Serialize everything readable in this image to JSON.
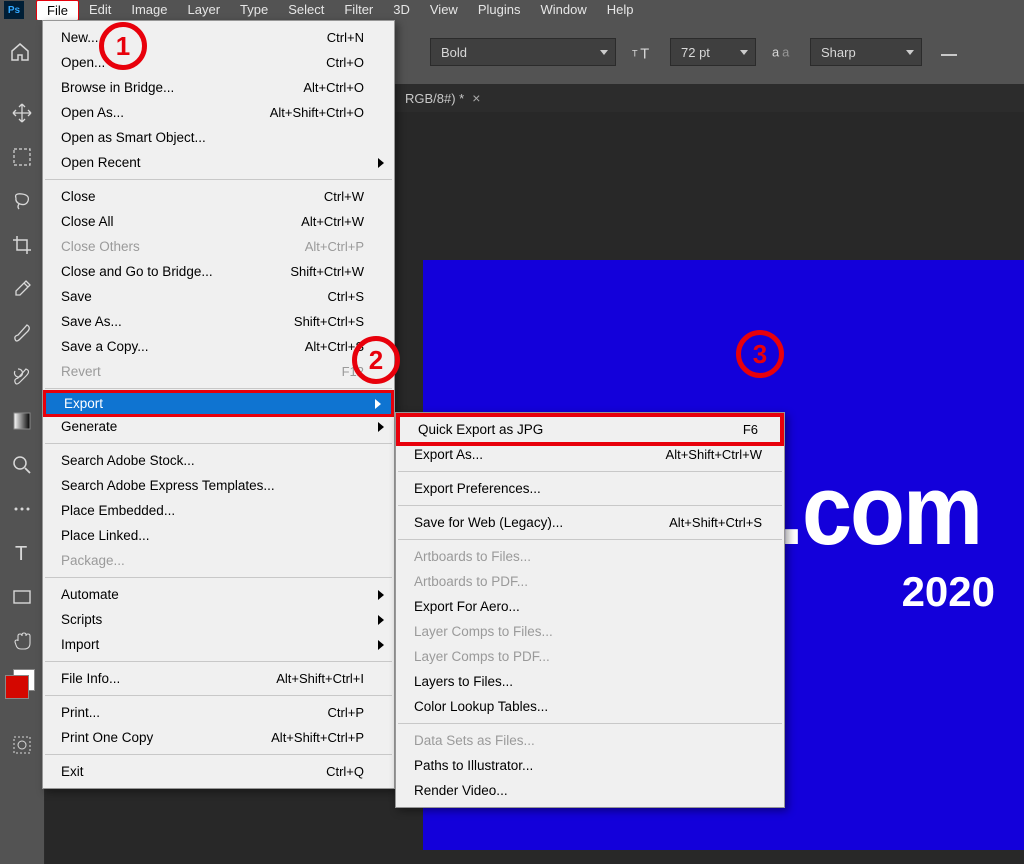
{
  "menubar": {
    "items": [
      "File",
      "Edit",
      "Image",
      "Layer",
      "Type",
      "Select",
      "Filter",
      "3D",
      "View",
      "Plugins",
      "Window",
      "Help"
    ]
  },
  "options": {
    "fontStyle": "Bold",
    "fontSize": "72 pt",
    "antialias": "Sharp"
  },
  "tab": {
    "label": "RGB/8#) *"
  },
  "document": {
    "textCom": ".com",
    "textYear": "2020"
  },
  "fileMenu": [
    {
      "label": "New...",
      "shortcut": "Ctrl+N"
    },
    {
      "label": "Open...",
      "shortcut": "Ctrl+O"
    },
    {
      "label": "Browse in Bridge...",
      "shortcut": "Alt+Ctrl+O"
    },
    {
      "label": "Open As...",
      "shortcut": "Alt+Shift+Ctrl+O"
    },
    {
      "label": "Open as Smart Object..."
    },
    {
      "label": "Open Recent",
      "arrow": true
    },
    {
      "sep": true
    },
    {
      "label": "Close",
      "shortcut": "Ctrl+W"
    },
    {
      "label": "Close All",
      "shortcut": "Alt+Ctrl+W"
    },
    {
      "label": "Close Others",
      "shortcut": "Alt+Ctrl+P",
      "disabled": true
    },
    {
      "label": "Close and Go to Bridge...",
      "shortcut": "Shift+Ctrl+W"
    },
    {
      "label": "Save",
      "shortcut": "Ctrl+S"
    },
    {
      "label": "Save As...",
      "shortcut": "Shift+Ctrl+S"
    },
    {
      "label": "Save a Copy...",
      "shortcut": "Alt+Ctrl+S"
    },
    {
      "label": "Revert",
      "shortcut": "F12",
      "disabled": true
    },
    {
      "sep": true
    },
    {
      "label": "Export",
      "arrow": true,
      "highlight": true,
      "export": true
    },
    {
      "label": "Generate",
      "arrow": true
    },
    {
      "sep": true
    },
    {
      "label": "Search Adobe Stock..."
    },
    {
      "label": "Search Adobe Express Templates..."
    },
    {
      "label": "Place Embedded..."
    },
    {
      "label": "Place Linked..."
    },
    {
      "label": "Package...",
      "disabled": true
    },
    {
      "sep": true
    },
    {
      "label": "Automate",
      "arrow": true
    },
    {
      "label": "Scripts",
      "arrow": true
    },
    {
      "label": "Import",
      "arrow": true
    },
    {
      "sep": true
    },
    {
      "label": "File Info...",
      "shortcut": "Alt+Shift+Ctrl+I"
    },
    {
      "sep": true
    },
    {
      "label": "Print...",
      "shortcut": "Ctrl+P"
    },
    {
      "label": "Print One Copy",
      "shortcut": "Alt+Shift+Ctrl+P"
    },
    {
      "sep": true
    },
    {
      "label": "Exit",
      "shortcut": "Ctrl+Q"
    }
  ],
  "exportMenu": [
    {
      "label": "Quick Export as JPG",
      "shortcut": "F6",
      "highlight": true
    },
    {
      "label": "Export As...",
      "shortcut": "Alt+Shift+Ctrl+W"
    },
    {
      "sep": true
    },
    {
      "label": "Export Preferences..."
    },
    {
      "sep": true
    },
    {
      "label": "Save for Web (Legacy)...",
      "shortcut": "Alt+Shift+Ctrl+S"
    },
    {
      "sep": true
    },
    {
      "label": "Artboards to Files...",
      "disabled": true
    },
    {
      "label": "Artboards to PDF...",
      "disabled": true
    },
    {
      "label": "Export For Aero..."
    },
    {
      "label": "Layer Comps to Files...",
      "disabled": true
    },
    {
      "label": "Layer Comps to PDF...",
      "disabled": true
    },
    {
      "label": "Layers to Files..."
    },
    {
      "label": "Color Lookup Tables..."
    },
    {
      "sep": true
    },
    {
      "label": "Data Sets as Files...",
      "disabled": true
    },
    {
      "label": "Paths to Illustrator..."
    },
    {
      "label": "Render Video..."
    }
  ],
  "markers": {
    "m1": "1",
    "m2": "2",
    "m3": "3"
  }
}
